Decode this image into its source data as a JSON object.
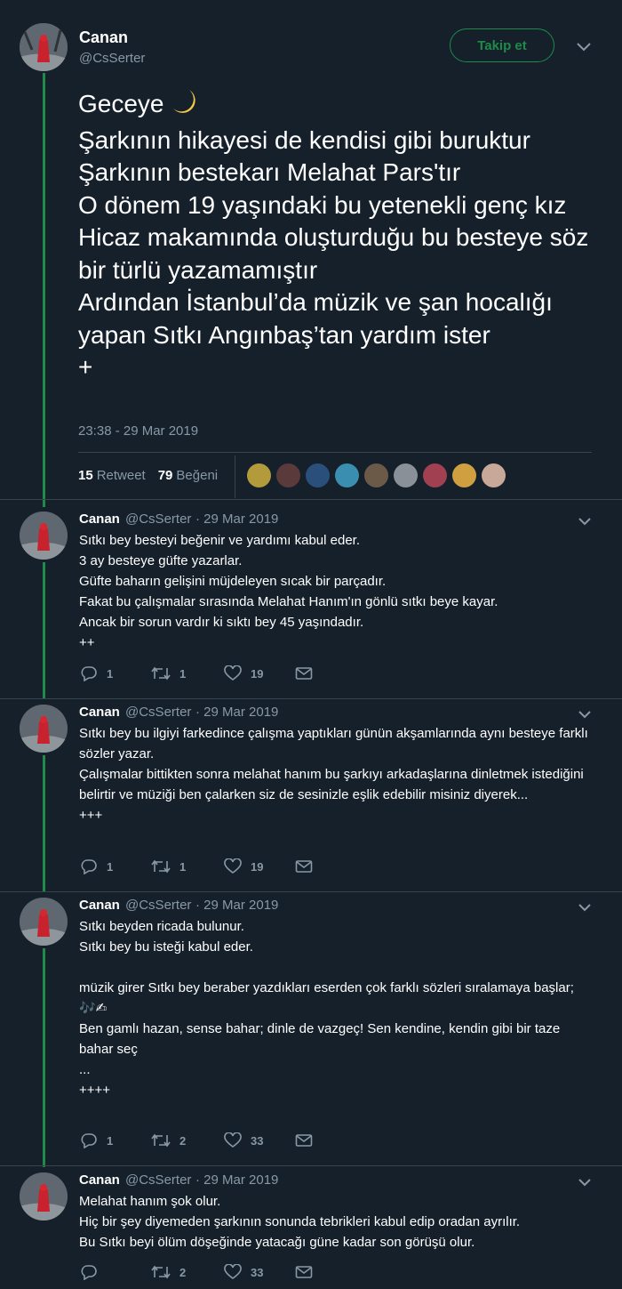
{
  "author": {
    "name": "Canan",
    "handle": "@CsSerter"
  },
  "follow_label": "Takip et",
  "main_tweet": {
    "text_first": "Geceye",
    "text_rest": "Şarkının hikayesi de kendisi gibi buruktur\nŞarkının bestekarı Melahat Pars'tır\nO dönem 19 yaşındaki bu yetenekli genç kız Hicaz makamında oluşturduğu bu besteye söz bir türlü yazamamıştır\nArdından İstanbul’da müzik ve şan hocalığı yapan Sıtkı Angınbaş’tan yardım ister\n+",
    "timestamp": "23:38 - 29 Mar 2019",
    "retweets": "15",
    "retweets_label": "Retweet",
    "likes": "79",
    "likes_label": "Beğeni"
  },
  "replies": [
    {
      "meta": "· 29 Mar 2019",
      "text": "Sıtkı bey besteyi beğenir ve yardımı kabul eder.\n3 ay besteye güfte yazarlar.\nGüfte baharın gelişini müjdeleyen sıcak bir parçadır.\nFakat bu çalışmalar sırasında Melahat Hanım'ın gönlü sıtkı beye kayar.\nAncak bir sorun vardır ki sıktı bey 45 yaşındadır.\n++",
      "reply_count": "1",
      "retweet_count": "1",
      "like_count": "19"
    },
    {
      "meta": "· 29 Mar 2019",
      "text": "Sıtkı bey bu ilgiyi farkedince çalışma yaptıkları günün akşamlarında aynı besteye farklı sözler yazar.\nÇalışmalar bittikten sonra melahat hanım bu şarkıyı arkadaşlarına dinletmek istediğini belirtir ve müziği ben çalarken siz de sesinizle eşlik edebilir misiniz diyerek...\n+++",
      "reply_count": "1",
      "retweet_count": "1",
      "like_count": "19"
    },
    {
      "meta": "· 29 Mar 2019",
      "text": "Sıtkı beyden ricada bulunur.\nSıtkı bey bu isteği kabul eder.\n\nmüzik girer Sıtkı bey beraber yazdıkları eserden çok farklı sözleri sıralamaya başlar;\n🎶✍\nBen gamlı hazan, sense bahar; dinle de vazgeç! Sen kendine, kendin gibi bir taze bahar seç\n...\n++++",
      "reply_count": "1",
      "retweet_count": "2",
      "like_count": "33"
    },
    {
      "meta": "· 29 Mar 2019",
      "text": "Melahat hanım şok olur.\nHiç bir şey diyemeden şarkının sonunda tebrikleri kabul edip oradan ayrılır.\nBu Sıtkı beyi ölüm döşeğinde yatacağı güne kadar son görüşü olur.",
      "reply_count": "",
      "retweet_count": "2",
      "like_count": "33"
    }
  ],
  "colors": {
    "background": "#15202b",
    "accent": "#1f8a4a",
    "muted": "#8899a6",
    "text": "#ffffff"
  },
  "icons": [
    "chevron-down-icon",
    "moon-icon",
    "reply-icon",
    "retweet-icon",
    "heart-icon",
    "mail-icon"
  ]
}
